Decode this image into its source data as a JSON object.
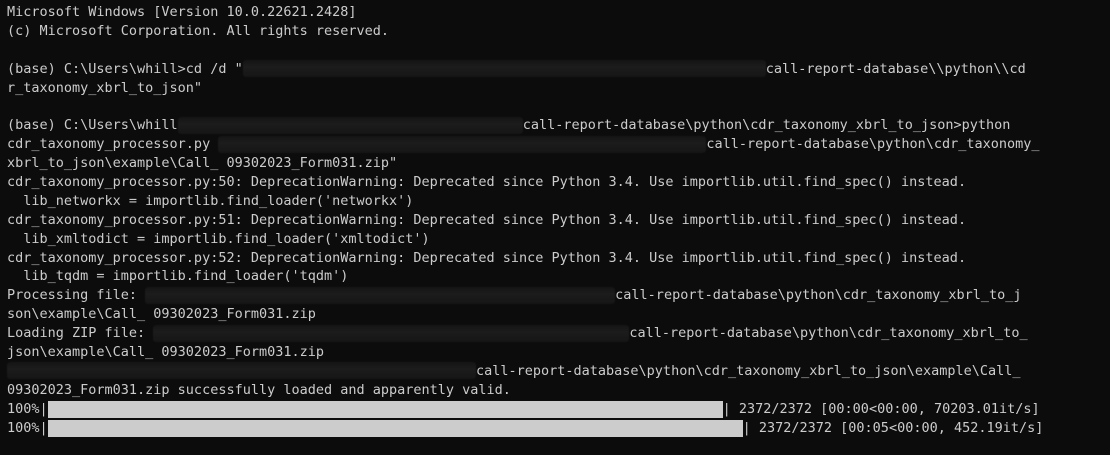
{
  "lines": {
    "l1": "Microsoft Windows [Version 10.0.22621.2428]",
    "l2": "(c) Microsoft Corporation. All rights reserved.",
    "cd_prefix": "(base) C:\\Users\\whill>cd /d \"",
    "cd_suffix": "call-report-database\\\\python\\\\cd",
    "cd_wrap": "r_taxonomy_xbrl_to_json\"",
    "run_prefix": "(base) C:\\Users\\whill",
    "run_suffix": "call-report-database\\python\\cdr_taxonomy_xbrl_to_json>python",
    "run2_prefix": "cdr_taxonomy_processor.py ",
    "run2_suffix": "call-report-database\\python\\cdr_taxonomy_",
    "run3": "xbrl_to_json\\example\\Call_ 09302023_Form031.zip\"",
    "warn1": "cdr_taxonomy_processor.py:50: DeprecationWarning: Deprecated since Python 3.4. Use importlib.util.find_spec() instead.",
    "warn1b": "  lib_networkx = importlib.find_loader('networkx')",
    "warn2": "cdr_taxonomy_processor.py:51: DeprecationWarning: Deprecated since Python 3.4. Use importlib.util.find_spec() instead.",
    "warn2b": "  lib_xmltodict = importlib.find_loader('xmltodict')",
    "warn3": "cdr_taxonomy_processor.py:52: DeprecationWarning: Deprecated since Python 3.4. Use importlib.util.find_spec() instead.",
    "warn3b": "  lib_tqdm = importlib.find_loader('tqdm')",
    "proc_prefix": "Processing file: ",
    "proc_suffix": "call-report-database\\python\\cdr_taxonomy_xbrl_to_j",
    "proc_wrap": "son\\example\\Call_ 09302023_Form031.zip",
    "load_prefix": "Loading ZIP file: ",
    "load_suffix": "call-report-database\\python\\cdr_taxonomy_xbrl_to_",
    "load_wrap": "json\\example\\Call_ 09302023_Form031.zip",
    "ok_suffix": "call-report-database\\python\\cdr_taxonomy_xbrl_to_json\\example\\Call_",
    "ok_wrap": "09302023_Form031.zip successfully loaded and apparently valid."
  },
  "progress": [
    {
      "percent_label": "100%|",
      "fraction": 1.0,
      "stats": "| 2372/2372 [00:00<00:00, 70203.01it/s]"
    },
    {
      "percent_label": "100%|",
      "fraction": 1.0,
      "stats": "| 2372/2372 [00:05<00:00, 452.19it/s]"
    }
  ],
  "colors": {
    "background": "#0c0c0c",
    "foreground": "#cccccc"
  }
}
